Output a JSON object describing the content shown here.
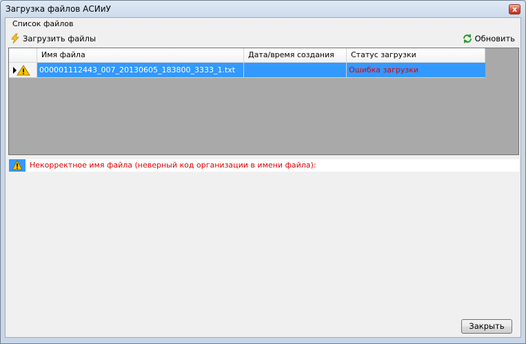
{
  "window": {
    "title": "Загрузка файлов АСИиУ",
    "close_glyph": "x"
  },
  "group": {
    "label": "Список файлов"
  },
  "toolbar": {
    "load_label": "Загрузить файлы",
    "refresh_label": "Обновить"
  },
  "table": {
    "columns": [
      "Имя файла",
      "Дата/время создания",
      "Статус загрузки"
    ],
    "rows": [
      {
        "name": "000001112443_007_20130605_183800_3333_1.txt",
        "created": "",
        "status": "Ошибка загрузки",
        "status_color": "#e00000",
        "warning": true
      }
    ]
  },
  "message": {
    "text": "Некорректное имя файла (неверный код организации в имени файла):"
  },
  "footer": {
    "close_label": "Закрыть"
  },
  "colors": {
    "selection": "#3399ff",
    "error": "#e00000",
    "grid_bg": "#a9a9a9"
  }
}
